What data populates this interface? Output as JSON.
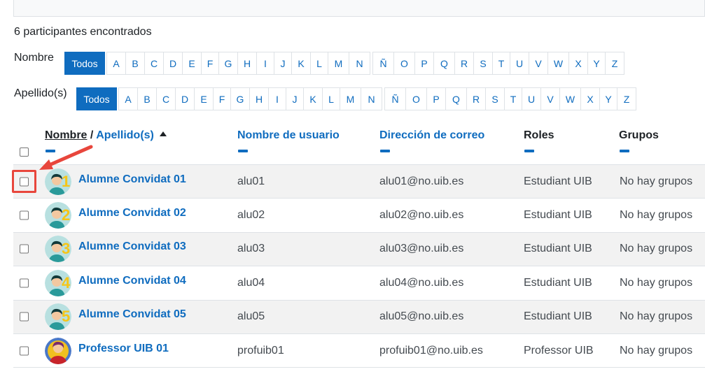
{
  "summary": {
    "found": "6 participantes encontrados"
  },
  "filters": {
    "first_name": {
      "label": "Nombre",
      "all": "Todos"
    },
    "last_name": {
      "label": "Apellido(s)",
      "all": "Todos"
    },
    "letters": [
      "A",
      "B",
      "C",
      "D",
      "E",
      "F",
      "G",
      "H",
      "I",
      "J",
      "K",
      "L",
      "M",
      "N",
      "Ñ",
      "O",
      "P",
      "Q",
      "R",
      "S",
      "T",
      "U",
      "V",
      "W",
      "X",
      "Y",
      "Z"
    ]
  },
  "table": {
    "headers": {
      "name": "Nombre",
      "separator": " / ",
      "surname": "Apellido(s)",
      "username": "Nombre de usuario",
      "email": "Dirección de correo",
      "roles": "Roles",
      "groups": "Grupos"
    },
    "rows": [
      {
        "name": "Alumne Convidat 01",
        "username": "alu01",
        "email": "alu01@no.uib.es",
        "role": "Estudiant UIB",
        "groups": "No hay grupos",
        "avatar_num": "1"
      },
      {
        "name": "Alumne Convidat 02",
        "username": "alu02",
        "email": "alu02@no.uib.es",
        "role": "Estudiant UIB",
        "groups": "No hay grupos",
        "avatar_num": "2"
      },
      {
        "name": "Alumne Convidat 03",
        "username": "alu03",
        "email": "alu03@no.uib.es",
        "role": "Estudiant UIB",
        "groups": "No hay grupos",
        "avatar_num": "3"
      },
      {
        "name": "Alumne Convidat 04",
        "username": "alu04",
        "email": "alu04@no.uib.es",
        "role": "Estudiant UIB",
        "groups": "No hay grupos",
        "avatar_num": "4"
      },
      {
        "name": "Alumne Convidat 05",
        "username": "alu05",
        "email": "alu05@no.uib.es",
        "role": "Estudiant UIB",
        "groups": "No hay grupos",
        "avatar_num": "5"
      },
      {
        "name": "Professor UIB 01",
        "username": "profuib01",
        "email": "profuib01@no.uib.es",
        "role": "Professor UIB",
        "groups": "No hay grupos",
        "avatar_num": ""
      }
    ]
  },
  "colors": {
    "link": "#0f6cbf",
    "annotation": "#e8463c",
    "row_stripe": "#f2f2f2"
  }
}
